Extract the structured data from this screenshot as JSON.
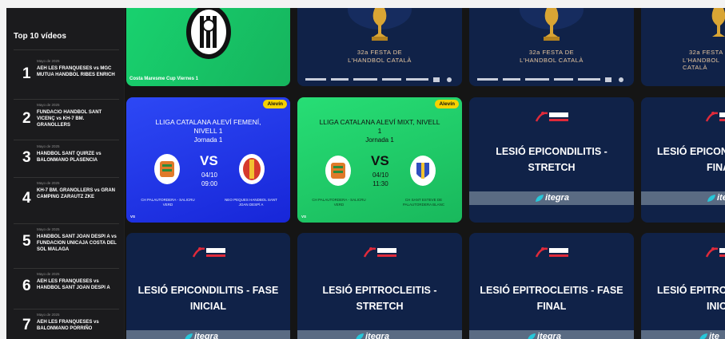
{
  "sidebar": {
    "title": "Top 10 vídeos",
    "items": [
      {
        "rank": "1",
        "date": "Mayo de 2025",
        "title": "AEH LES FRANQUESES vs MGC MUTUA HANDBOL RIBES ENRICH"
      },
      {
        "rank": "2",
        "date": "Mayo de 2025",
        "title": "FUNDACIO HANDBOL SANT VICENÇ vs KH-7 BM. GRANOLLERS"
      },
      {
        "rank": "3",
        "date": "Mayo de 2025",
        "title": "HANDBOL SANT QUIRZE vs BALONMANO PLASENCIA"
      },
      {
        "rank": "4",
        "date": "Mayo de 2025",
        "title": "KH-7 BM. GRANOLLERS vs GRAN CAMPING ZARAUTZ ZKE"
      },
      {
        "rank": "5",
        "date": "Mayo de 2025",
        "title": "HANDBOL SANT JOAN DESPI A vs FUNDACION UNICAJA COSTA DEL SOL MALAGA"
      },
      {
        "rank": "6",
        "date": "Mayo de 2025",
        "title": "AEH LES FRANQUESES vs HANDBOL SANT JOAN DESPI A"
      },
      {
        "rank": "7",
        "date": "Mayo de 2025",
        "title": "AEH LES FRANQUESES vs BALONMANO PORRIÑO"
      }
    ]
  },
  "row1": {
    "green_caption": "Costa Maresme Cup Viernes 1",
    "festa_line1": "32a FESTA DE",
    "festa_line2": "L'HANDBOL CATALÀ"
  },
  "row2": {
    "card1": {
      "badge": "Alevín",
      "title_line1": "LLIGA CATALANA ALEVÍ FEMENÍ,",
      "title_line2": "NIVELL 1",
      "title_line3": "Jornada 1",
      "vs": "VS",
      "date": "04/10",
      "time": "09:00",
      "team_left": "CH PALAUTORDERA - SALICRU VERD",
      "team_right": "NEO PEQUES HANDBOL SANT JOAN DESPÍ A",
      "corner": "VS"
    },
    "card2": {
      "badge": "Alevín",
      "title_line1": "LLIGA CATALANA ALEVÍ MIXT, NIVELL",
      "title_line2": "1",
      "title_line3": "Jornada 1",
      "vs": "VS",
      "date": "04/10",
      "time": "11:30",
      "team_left": "CH PALAUTORDERA - SALICRU VERD",
      "team_right": "CH SANT ESTEVE DE PALAUTORDERA BLANC",
      "corner": "VS"
    },
    "card3": {
      "line1": "LESIÓ EPICONDILITIS -",
      "line2": "STRETCH",
      "brand": "itegra"
    },
    "card4": {
      "line1": "LESIÓ EPICOND",
      "line2": "FINA",
      "brand": "ite"
    }
  },
  "row3": {
    "card1": {
      "line1": "LESIÓ EPICONDILITIS - FASE",
      "line2": "INICIAL",
      "brand": "itegra"
    },
    "card2": {
      "line1": "LESIÓ EPITROCLEITIS -",
      "line2": "STRETCH",
      "brand": "itegra"
    },
    "card3": {
      "line1": "LESIÓ EPITROCLEITIS - FASE",
      "line2": "FINAL",
      "brand": "itegra"
    },
    "card4": {
      "line1": "LESIÓ EPITROC",
      "line2": "INICI",
      "brand": "ite"
    }
  },
  "colors": {
    "background": "#151515",
    "sidebar": "#1b1b1d",
    "blue_card": "#1a2ee8",
    "green_card": "#1fc86a",
    "badge": "#f5d100",
    "navy": "#102248"
  }
}
